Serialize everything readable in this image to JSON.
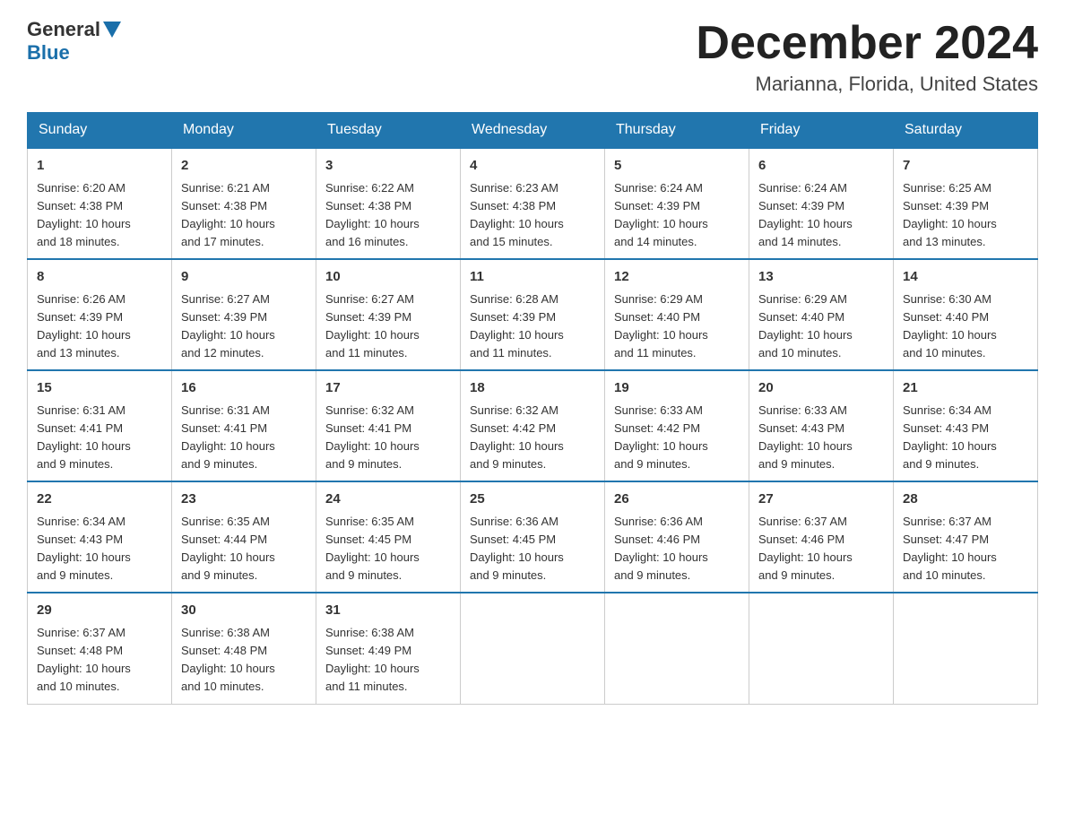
{
  "logo": {
    "text_general": "General",
    "text_blue": "Blue"
  },
  "title": {
    "month_year": "December 2024",
    "location": "Marianna, Florida, United States"
  },
  "weekdays": [
    "Sunday",
    "Monday",
    "Tuesday",
    "Wednesday",
    "Thursday",
    "Friday",
    "Saturday"
  ],
  "weeks": [
    [
      {
        "day": "1",
        "sunrise": "6:20 AM",
        "sunset": "4:38 PM",
        "daylight": "10 hours and 18 minutes."
      },
      {
        "day": "2",
        "sunrise": "6:21 AM",
        "sunset": "4:38 PM",
        "daylight": "10 hours and 17 minutes."
      },
      {
        "day": "3",
        "sunrise": "6:22 AM",
        "sunset": "4:38 PM",
        "daylight": "10 hours and 16 minutes."
      },
      {
        "day": "4",
        "sunrise": "6:23 AM",
        "sunset": "4:38 PM",
        "daylight": "10 hours and 15 minutes."
      },
      {
        "day": "5",
        "sunrise": "6:24 AM",
        "sunset": "4:39 PM",
        "daylight": "10 hours and 14 minutes."
      },
      {
        "day": "6",
        "sunrise": "6:24 AM",
        "sunset": "4:39 PM",
        "daylight": "10 hours and 14 minutes."
      },
      {
        "day": "7",
        "sunrise": "6:25 AM",
        "sunset": "4:39 PM",
        "daylight": "10 hours and 13 minutes."
      }
    ],
    [
      {
        "day": "8",
        "sunrise": "6:26 AM",
        "sunset": "4:39 PM",
        "daylight": "10 hours and 13 minutes."
      },
      {
        "day": "9",
        "sunrise": "6:27 AM",
        "sunset": "4:39 PM",
        "daylight": "10 hours and 12 minutes."
      },
      {
        "day": "10",
        "sunrise": "6:27 AM",
        "sunset": "4:39 PM",
        "daylight": "10 hours and 11 minutes."
      },
      {
        "day": "11",
        "sunrise": "6:28 AM",
        "sunset": "4:39 PM",
        "daylight": "10 hours and 11 minutes."
      },
      {
        "day": "12",
        "sunrise": "6:29 AM",
        "sunset": "4:40 PM",
        "daylight": "10 hours and 11 minutes."
      },
      {
        "day": "13",
        "sunrise": "6:29 AM",
        "sunset": "4:40 PM",
        "daylight": "10 hours and 10 minutes."
      },
      {
        "day": "14",
        "sunrise": "6:30 AM",
        "sunset": "4:40 PM",
        "daylight": "10 hours and 10 minutes."
      }
    ],
    [
      {
        "day": "15",
        "sunrise": "6:31 AM",
        "sunset": "4:41 PM",
        "daylight": "10 hours and 9 minutes."
      },
      {
        "day": "16",
        "sunrise": "6:31 AM",
        "sunset": "4:41 PM",
        "daylight": "10 hours and 9 minutes."
      },
      {
        "day": "17",
        "sunrise": "6:32 AM",
        "sunset": "4:41 PM",
        "daylight": "10 hours and 9 minutes."
      },
      {
        "day": "18",
        "sunrise": "6:32 AM",
        "sunset": "4:42 PM",
        "daylight": "10 hours and 9 minutes."
      },
      {
        "day": "19",
        "sunrise": "6:33 AM",
        "sunset": "4:42 PM",
        "daylight": "10 hours and 9 minutes."
      },
      {
        "day": "20",
        "sunrise": "6:33 AM",
        "sunset": "4:43 PM",
        "daylight": "10 hours and 9 minutes."
      },
      {
        "day": "21",
        "sunrise": "6:34 AM",
        "sunset": "4:43 PM",
        "daylight": "10 hours and 9 minutes."
      }
    ],
    [
      {
        "day": "22",
        "sunrise": "6:34 AM",
        "sunset": "4:43 PM",
        "daylight": "10 hours and 9 minutes."
      },
      {
        "day": "23",
        "sunrise": "6:35 AM",
        "sunset": "4:44 PM",
        "daylight": "10 hours and 9 minutes."
      },
      {
        "day": "24",
        "sunrise": "6:35 AM",
        "sunset": "4:45 PM",
        "daylight": "10 hours and 9 minutes."
      },
      {
        "day": "25",
        "sunrise": "6:36 AM",
        "sunset": "4:45 PM",
        "daylight": "10 hours and 9 minutes."
      },
      {
        "day": "26",
        "sunrise": "6:36 AM",
        "sunset": "4:46 PM",
        "daylight": "10 hours and 9 minutes."
      },
      {
        "day": "27",
        "sunrise": "6:37 AM",
        "sunset": "4:46 PM",
        "daylight": "10 hours and 9 minutes."
      },
      {
        "day": "28",
        "sunrise": "6:37 AM",
        "sunset": "4:47 PM",
        "daylight": "10 hours and 10 minutes."
      }
    ],
    [
      {
        "day": "29",
        "sunrise": "6:37 AM",
        "sunset": "4:48 PM",
        "daylight": "10 hours and 10 minutes."
      },
      {
        "day": "30",
        "sunrise": "6:38 AM",
        "sunset": "4:48 PM",
        "daylight": "10 hours and 10 minutes."
      },
      {
        "day": "31",
        "sunrise": "6:38 AM",
        "sunset": "4:49 PM",
        "daylight": "10 hours and 11 minutes."
      },
      null,
      null,
      null,
      null
    ]
  ],
  "labels": {
    "sunrise": "Sunrise:",
    "sunset": "Sunset:",
    "daylight": "Daylight:"
  }
}
